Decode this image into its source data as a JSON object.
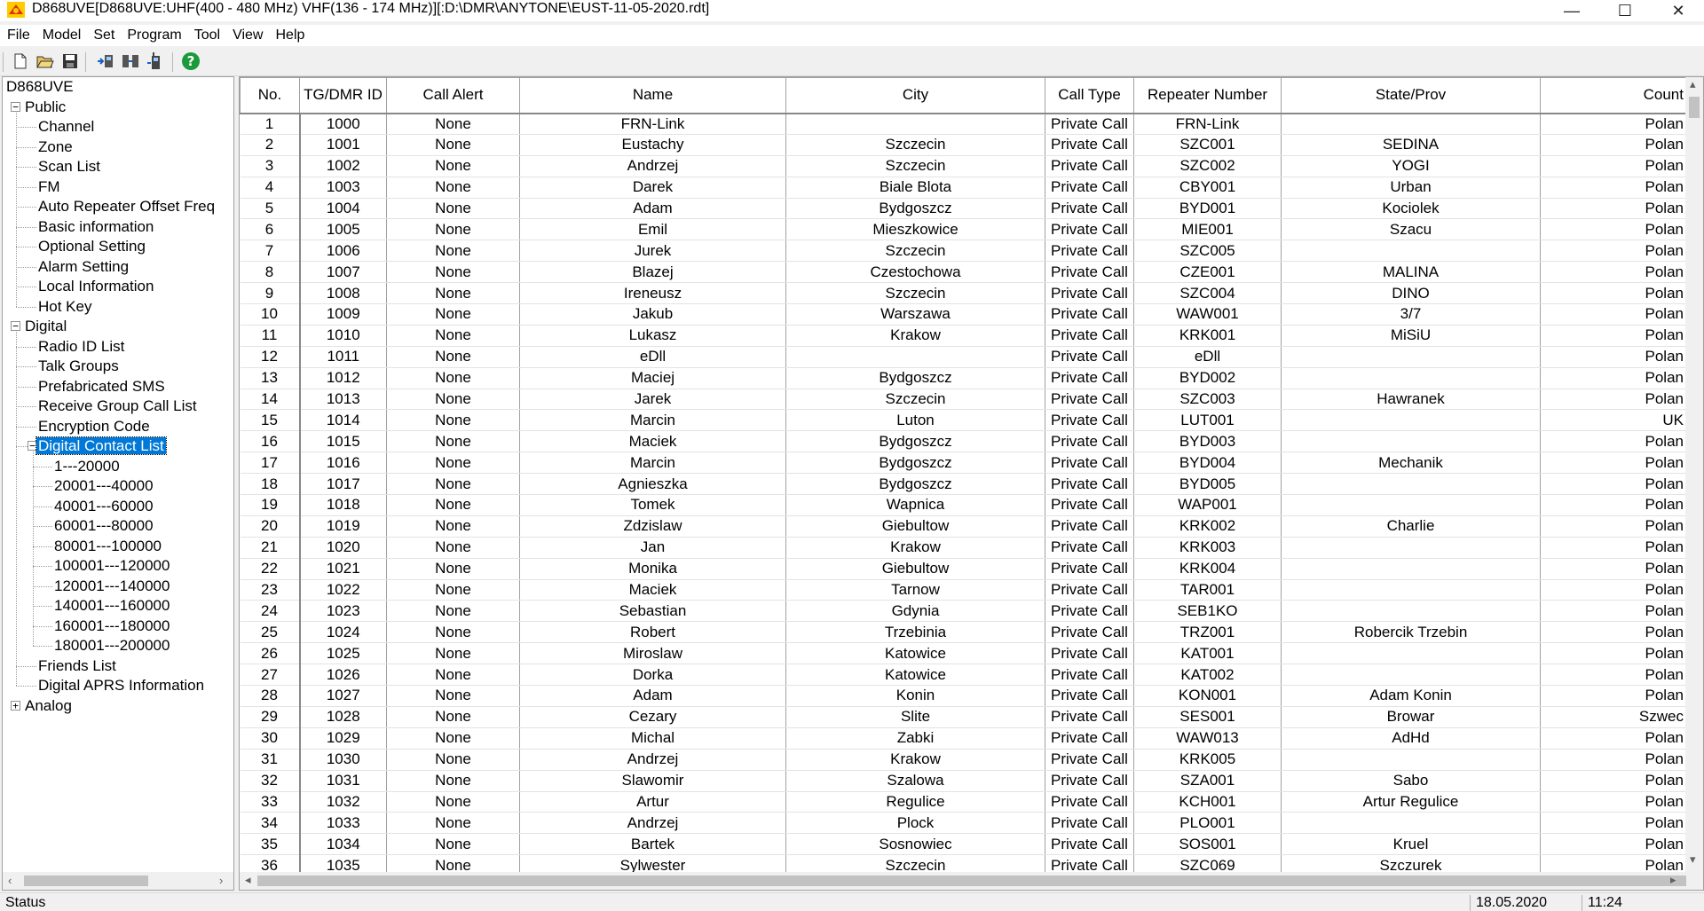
{
  "window": {
    "title": "D868UVE[D868UVE:UHF(400 - 480 MHz) VHF(136 - 174 MHz)][:D:\\DMR\\ANYTONE\\EUST-11-05-2020.rdt]",
    "minimize_glyph": "—",
    "maximize_glyph": "☐",
    "close_glyph": "✕"
  },
  "menu": [
    "File",
    "Model",
    "Set",
    "Program",
    "Tool",
    "View",
    "Help"
  ],
  "toolbar_icons": [
    "new-file-icon",
    "open-folder-icon",
    "save-icon",
    "read-from-radio-icon",
    "write-to-radio-icon",
    "radio-device-icon",
    "help-icon"
  ],
  "tree": {
    "root": "D868UVE",
    "public_label": "Public",
    "public_items": [
      "Channel",
      "Zone",
      "Scan List",
      "FM",
      "Auto Repeater Offset Freq",
      "Basic information",
      "Optional Setting",
      "Alarm Setting",
      "Local Information",
      "Hot Key"
    ],
    "digital_label": "Digital",
    "digital_items": [
      "Radio ID List",
      "Talk Groups",
      "Prefabricated SMS",
      "Receive Group Call List",
      "Encryption Code"
    ],
    "contact_list_label": "Digital Contact List",
    "contact_ranges": [
      "1---20000",
      "20001---40000",
      "40001---60000",
      "60001---80000",
      "80001---100000",
      "100001---120000",
      "120001---140000",
      "140001---160000",
      "160001---180000",
      "180001---200000"
    ],
    "digital_tail_items": [
      "Friends List",
      "Digital APRS Information"
    ],
    "analog_label": "Analog"
  },
  "grid": {
    "columns": [
      "No.",
      "TG/DMR ID",
      "Call Alert",
      "Name",
      "City",
      "Call Type",
      "Repeater Number",
      "State/Prov",
      "Count"
    ],
    "rows": [
      [
        "1",
        "1000",
        "None",
        "FRN-Link",
        "",
        "Private Call",
        "FRN-Link",
        "",
        "Polan"
      ],
      [
        "2",
        "1001",
        "None",
        "Eustachy",
        "Szczecin",
        "Private Call",
        "SZC001",
        "SEDINA",
        "Polan"
      ],
      [
        "3",
        "1002",
        "None",
        "Andrzej",
        "Szczecin",
        "Private Call",
        "SZC002",
        "YOGI",
        "Polan"
      ],
      [
        "4",
        "1003",
        "None",
        "Darek",
        "Biale Blota",
        "Private Call",
        "CBY001",
        "Urban",
        "Polan"
      ],
      [
        "5",
        "1004",
        "None",
        "Adam",
        "Bydgoszcz",
        "Private Call",
        "BYD001",
        "Kociolek",
        "Polan"
      ],
      [
        "6",
        "1005",
        "None",
        "Emil",
        "Mieszkowice",
        "Private Call",
        "MIE001",
        "Szacu",
        "Polan"
      ],
      [
        "7",
        "1006",
        "None",
        "Jurek",
        "Szczecin",
        "Private Call",
        "SZC005",
        "",
        "Polan"
      ],
      [
        "8",
        "1007",
        "None",
        "Blazej",
        "Czestochowa",
        "Private Call",
        "CZE001",
        "MALINA",
        "Polan"
      ],
      [
        "9",
        "1008",
        "None",
        "Ireneusz",
        "Szczecin",
        "Private Call",
        "SZC004",
        "DINO",
        "Polan"
      ],
      [
        "10",
        "1009",
        "None",
        "Jakub",
        "Warszawa",
        "Private Call",
        "WAW001",
        "3/7",
        "Polan"
      ],
      [
        "11",
        "1010",
        "None",
        "Lukasz",
        "Krakow",
        "Private Call",
        "KRK001",
        "MiSiU",
        "Polan"
      ],
      [
        "12",
        "1011",
        "None",
        "eDll",
        "",
        "Private Call",
        "eDll",
        "",
        "Polan"
      ],
      [
        "13",
        "1012",
        "None",
        "Maciej",
        "Bydgoszcz",
        "Private Call",
        "BYD002",
        "",
        "Polan"
      ],
      [
        "14",
        "1013",
        "None",
        "Jarek",
        "Szczecin",
        "Private Call",
        "SZC003",
        "Hawranek",
        "Polan"
      ],
      [
        "15",
        "1014",
        "None",
        "Marcin",
        "Luton",
        "Private Call",
        "LUT001",
        "",
        "UK"
      ],
      [
        "16",
        "1015",
        "None",
        "Maciek",
        "Bydgoszcz",
        "Private Call",
        "BYD003",
        "",
        "Polan"
      ],
      [
        "17",
        "1016",
        "None",
        "Marcin",
        "Bydgoszcz",
        "Private Call",
        "BYD004",
        "Mechanik",
        "Polan"
      ],
      [
        "18",
        "1017",
        "None",
        "Agnieszka",
        "Bydgoszcz",
        "Private Call",
        "BYD005",
        "",
        "Polan"
      ],
      [
        "19",
        "1018",
        "None",
        "Tomek",
        "Wapnica",
        "Private Call",
        "WAP001",
        "",
        "Polan"
      ],
      [
        "20",
        "1019",
        "None",
        "Zdzislaw",
        "Giebultow",
        "Private Call",
        "KRK002",
        "Charlie",
        "Polan"
      ],
      [
        "21",
        "1020",
        "None",
        "Jan",
        "Krakow",
        "Private Call",
        "KRK003",
        "",
        "Polan"
      ],
      [
        "22",
        "1021",
        "None",
        "Monika",
        "Giebultow",
        "Private Call",
        "KRK004",
        "",
        "Polan"
      ],
      [
        "23",
        "1022",
        "None",
        "Maciek",
        "Tarnow",
        "Private Call",
        "TAR001",
        "",
        "Polan"
      ],
      [
        "24",
        "1023",
        "None",
        "Sebastian",
        "Gdynia",
        "Private Call",
        "SEB1KO",
        "",
        "Polan"
      ],
      [
        "25",
        "1024",
        "None",
        "Robert",
        "Trzebinia",
        "Private Call",
        "TRZ001",
        "Robercik Trzebin",
        "Polan"
      ],
      [
        "26",
        "1025",
        "None",
        "Miroslaw",
        "Katowice",
        "Private Call",
        "KAT001",
        "",
        "Polan"
      ],
      [
        "27",
        "1026",
        "None",
        "Dorka",
        "Katowice",
        "Private Call",
        "KAT002",
        "",
        "Polan"
      ],
      [
        "28",
        "1027",
        "None",
        "Adam",
        "Konin",
        "Private Call",
        "KON001",
        "Adam Konin",
        "Polan"
      ],
      [
        "29",
        "1028",
        "None",
        "Cezary",
        "Slite",
        "Private Call",
        "SES001",
        "Browar",
        "Szwec"
      ],
      [
        "30",
        "1029",
        "None",
        "Michal",
        "Zabki",
        "Private Call",
        "WAW013",
        "AdHd",
        "Polan"
      ],
      [
        "31",
        "1030",
        "None",
        "Andrzej",
        "Krakow",
        "Private Call",
        "KRK005",
        "",
        "Polan"
      ],
      [
        "32",
        "1031",
        "None",
        "Slawomir",
        "Szalowa",
        "Private Call",
        "SZA001",
        "Sabo",
        "Polan"
      ],
      [
        "33",
        "1032",
        "None",
        "Artur",
        "Regulice",
        "Private Call",
        "KCH001",
        "Artur Regulice",
        "Polan"
      ],
      [
        "34",
        "1033",
        "None",
        "Andrzej",
        "Plock",
        "Private Call",
        "PLO001",
        "",
        "Polan"
      ],
      [
        "35",
        "1034",
        "None",
        "Bartek",
        "Sosnowiec",
        "Private Call",
        "SOS001",
        "Kruel",
        "Polan"
      ],
      [
        "36",
        "1035",
        "None",
        "Sylwester",
        "Szczecin",
        "Private Call",
        "SZC069",
        "Szczurek",
        "Polan"
      ]
    ]
  },
  "status": {
    "label": "Status",
    "date": "18.05.2020",
    "time": "11:24"
  },
  "colors": {
    "selection": "#0078d7",
    "grid_border": "#a0a0a0"
  }
}
